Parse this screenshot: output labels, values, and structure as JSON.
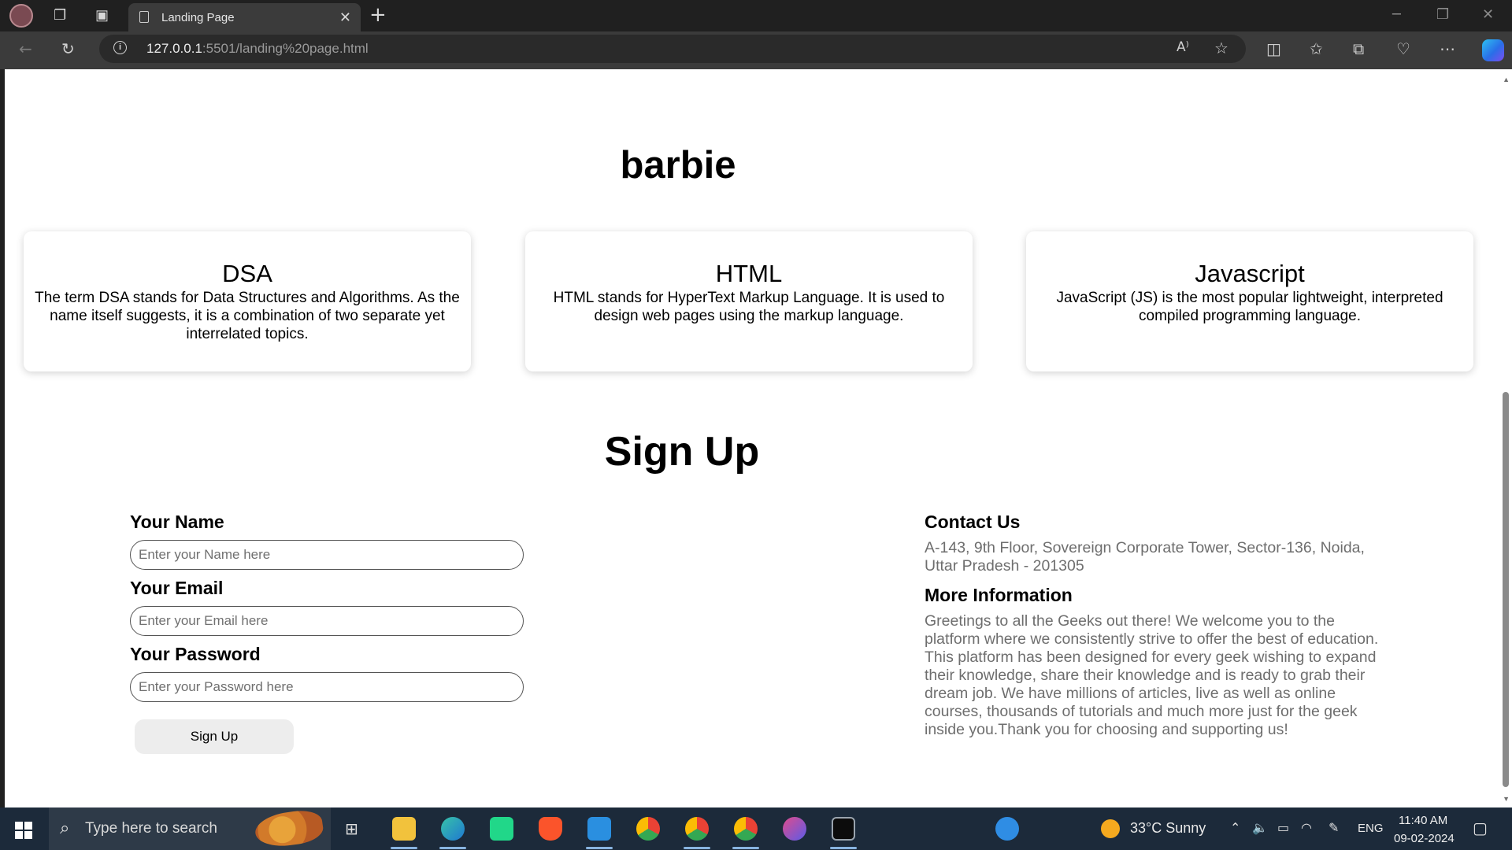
{
  "browser": {
    "tab_title": "Landing Page",
    "tab_close": "✕",
    "new_tab": "+",
    "url_host": "127.0.0.1",
    "url_rest": ":5501/landing%20page.html",
    "read_aloud_icon": "A⁾"
  },
  "page": {
    "title": "barbie",
    "cards": [
      {
        "title": "DSA",
        "text": "The term DSA stands for Data Structures and Algorithms. As the name itself suggests, it is a combination of two separate yet interrelated topics."
      },
      {
        "title": "HTML",
        "text": "HTML stands for HyperText Markup Language. It is used to design web pages using the markup language."
      },
      {
        "title": "Javascript",
        "text": "JavaScript (JS) is the most popular lightweight, interpreted compiled programming language."
      }
    ],
    "signup_title": "Sign Up",
    "form": {
      "name_label": "Your Name",
      "name_placeholder": "Enter your Name here",
      "email_label": "Your Email",
      "email_placeholder": "Enter your Email here",
      "password_label": "Your Password",
      "password_placeholder": "Enter your Password here",
      "submit_label": "Sign Up"
    },
    "contact": {
      "heading": "Contact Us",
      "address": "A-143, 9th Floor, Sovereign Corporate Tower, Sector-136, Noida, Uttar Pradesh - 201305",
      "more_heading": "More Information",
      "more_text": "Greetings to all the Geeks out there! We welcome you to the platform where we consistently strive to offer the best of education. This platform has been designed for every geek wishing to expand their knowledge, share their knowledge and is ready to grab their dream job. We have millions of articles, live as well as online courses, thousands of tutorials and much more just for the geek inside you.Thank you for choosing and supporting us!"
    }
  },
  "taskbar": {
    "search_placeholder": "Type here to search",
    "weather": "33°C  Sunny",
    "language": "ENG",
    "time": "11:40 AM",
    "date": "09-02-2024"
  },
  "colors": {
    "chrome_bg": "#202020",
    "toolbar_bg": "#3b3b3b",
    "taskbar_bg": "#1c2a3a",
    "contact_text": "#6e6e6e"
  }
}
